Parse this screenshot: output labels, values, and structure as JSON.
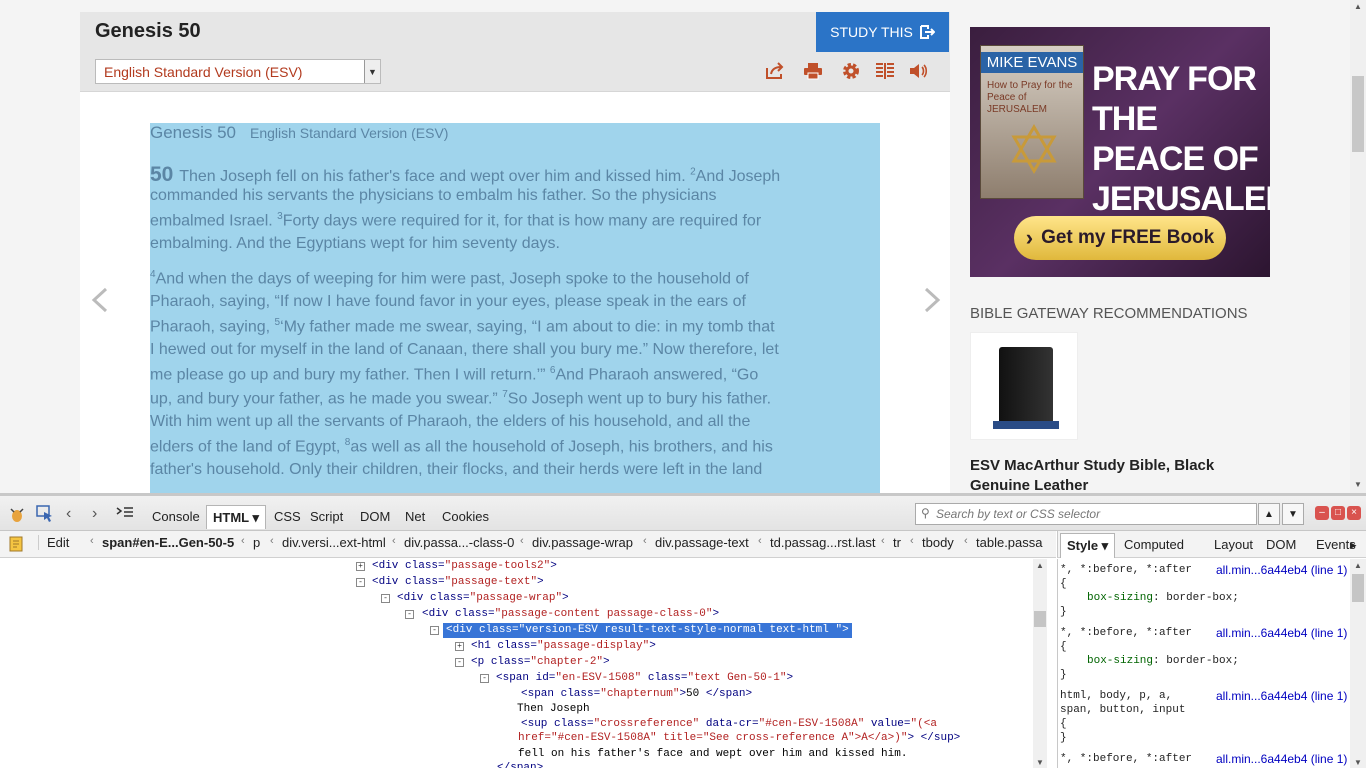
{
  "header": {
    "title": "Genesis 50",
    "study_label": "STUDY THIS",
    "version": "English Standard Version (ESV)"
  },
  "tools": [
    "share-icon",
    "print-icon",
    "settings-icon",
    "parallel-icon",
    "audio-icon"
  ],
  "passage": {
    "heading": "Genesis 50",
    "heading_version": "English Standard Version (ESV)",
    "chapter_num": "50",
    "lines": [
      [
        "",
        "Then Joseph fell on his father's face and wept over him and kissed him. ",
        "2",
        "And Joseph"
      ],
      [
        "",
        "commanded his servants the physicians to embalm his father. So the physicians",
        "",
        ""
      ],
      [
        "",
        "embalmed Israel. ",
        "3",
        "Forty days were required for it, for that is how many are required for"
      ],
      [
        "",
        "embalming. And the Egyptians wept for him seventy days.",
        "",
        ""
      ],
      [
        "4",
        "And when the days of weeping for him were past, Joseph spoke to the household of",
        "",
        ""
      ],
      [
        "",
        "Pharaoh, saying, “If now I have found favor in your eyes, please speak in the ears of",
        "",
        ""
      ],
      [
        "",
        "Pharaoh, saying, ",
        "5",
        "‘My father made me swear, saying, “I am about to die: in my tomb that"
      ],
      [
        "",
        "I hewed out for myself in the land of Canaan, there shall you bury me.” Now therefore, let",
        "",
        ""
      ],
      [
        "",
        "me please go up and bury my father. Then I will return.’” ",
        "6",
        "And Pharaoh answered, “Go"
      ],
      [
        "",
        "up, and bury your father, as he made you swear.” ",
        "7",
        "So Joseph went up to bury his father."
      ],
      [
        "",
        "With him went up all the servants of Pharaoh, the elders of his household, and all the",
        "",
        ""
      ],
      [
        "",
        "elders of the land of Egypt, ",
        "8",
        "as well as all the household of Joseph, his brothers, and his"
      ],
      [
        "",
        "father's household. Only their children, their flocks, and their herds were left in the land",
        "",
        ""
      ]
    ]
  },
  "ad": {
    "author": "MIKE EVANS",
    "book_title": "How to Pray for the Peace of JERUSALEM",
    "headline": "PRAY FOR THE PEACE OF JERUSALEM",
    "cta": "Get my FREE Book"
  },
  "recommendations": {
    "heading": "BIBLE GATEWAY RECOMMENDATIONS",
    "title": "ESV MacArthur Study Bible, Black Genuine Leather"
  },
  "firebug": {
    "tabs": [
      "Console",
      "HTML",
      "CSS",
      "Script",
      "DOM",
      "Net",
      "Cookies"
    ],
    "search_placeholder": "Search by text or CSS selector",
    "edit_label": "Edit",
    "breadcrumbs": [
      "span#en-E...Gen-50-5",
      "p",
      "div.versi...ext-html",
      "div.passa...-class-0",
      "div.passage-wrap",
      "div.passage-text",
      "td.passag...rst.last",
      "tr",
      "tbody",
      "table.passa"
    ],
    "side_tabs": [
      "Style",
      "Computed",
      "Layout",
      "DOM",
      "Events"
    ],
    "html_lines": [
      {
        "tw": "+",
        "parts": [
          [
            "tg",
            "<div "
          ],
          [
            "an",
            "class="
          ],
          [
            "av",
            "\"passage-tools2\""
          ],
          [
            "tg",
            ">"
          ]
        ]
      },
      {
        "tw": "-",
        "parts": [
          [
            "tg",
            "<div "
          ],
          [
            "an",
            "class="
          ],
          [
            "av",
            "\"passage-text\""
          ],
          [
            "tg",
            ">"
          ]
        ]
      },
      {
        "tw": "-",
        "parts": [
          [
            "tg",
            "<div "
          ],
          [
            "an",
            "class="
          ],
          [
            "av",
            "\"passage-wrap\""
          ],
          [
            "tg",
            ">"
          ]
        ]
      },
      {
        "tw": "-",
        "parts": [
          [
            "tg",
            "<div "
          ],
          [
            "an",
            "class="
          ],
          [
            "av",
            "\"passage-content passage-class-0\""
          ],
          [
            "tg",
            ">"
          ]
        ]
      },
      {
        "tw": "-",
        "sel": true,
        "parts": [
          [
            "tg",
            "<div "
          ],
          [
            "an",
            "class="
          ],
          [
            "av",
            "\"version-ESV result-text-style-normal text-html \""
          ],
          [
            "tg",
            ">"
          ]
        ]
      },
      {
        "tw": "+",
        "parts": [
          [
            "tg",
            "<h1 "
          ],
          [
            "an",
            "class="
          ],
          [
            "av",
            "\"passage-display\""
          ],
          [
            "tg",
            ">"
          ]
        ]
      },
      {
        "tw": "-",
        "parts": [
          [
            "tg",
            "<p "
          ],
          [
            "an",
            "class="
          ],
          [
            "av",
            "\"chapter-2\""
          ],
          [
            "tg",
            ">"
          ]
        ]
      },
      {
        "tw": "-",
        "parts": [
          [
            "tg",
            "<span "
          ],
          [
            "an",
            "id="
          ],
          [
            "av",
            "\"en-ESV-1508\""
          ],
          [
            "an",
            " class="
          ],
          [
            "av",
            "\"text Gen-50-1\""
          ],
          [
            "tg",
            ">"
          ]
        ]
      },
      {
        "tw": "",
        "parts": [
          [
            "tg",
            "<span "
          ],
          [
            "an",
            "class="
          ],
          [
            "av",
            "\"chapternum\""
          ],
          [
            "tg",
            ">"
          ],
          [
            "tx",
            "50 "
          ],
          [
            "tg",
            "</span>"
          ]
        ]
      },
      {
        "tw": "",
        "parts": [
          [
            "tx",
            "Then Joseph"
          ]
        ]
      },
      {
        "tw": "",
        "parts": [
          [
            "tg",
            "<sup "
          ],
          [
            "an",
            "class="
          ],
          [
            "av",
            "\"crossreference\""
          ],
          [
            "an",
            " data-cr="
          ],
          [
            "av",
            "\"#cen-ESV-1508A\""
          ],
          [
            "an",
            " value="
          ],
          [
            "av",
            "\"(<a"
          ]
        ]
      },
      {
        "tw": "",
        "parts": [
          [
            "av",
            "href=\"#cen-ESV-1508A\" title=\"See cross-reference A\">A</a>)\""
          ],
          [
            "tg",
            ">"
          ],
          [
            "tg",
            " </sup>"
          ]
        ]
      },
      {
        "tw": "",
        "parts": [
          [
            "tx",
            "fell on his father's face and wept over him and kissed him."
          ]
        ]
      },
      {
        "tw": "",
        "parts": [
          [
            "tg",
            "</span>"
          ]
        ]
      }
    ],
    "css_lines": [
      {
        "sel": "*, *:before, *:after",
        "src": "all.min...6a44eb4 (line 1)"
      },
      {
        "text": "{"
      },
      {
        "prop": "box-sizing",
        "val": "border-box;"
      },
      {
        "text": "}"
      },
      {
        "sel": "*, *:before, *:after",
        "src": "all.min...6a44eb4 (line 1)"
      },
      {
        "text": "{"
      },
      {
        "prop": "box-sizing",
        "val": "border-box;"
      },
      {
        "text": "}"
      },
      {
        "sel": "html, body, p, a,",
        "src": "all.min...6a44eb4 (line 1)"
      },
      {
        "text": "span, button, input"
      },
      {
        "text": "{"
      },
      {
        "text": "}"
      },
      {
        "sel": "*, *:before, *:after",
        "src": "all.min...6a44eb4 (line 1)"
      }
    ]
  }
}
